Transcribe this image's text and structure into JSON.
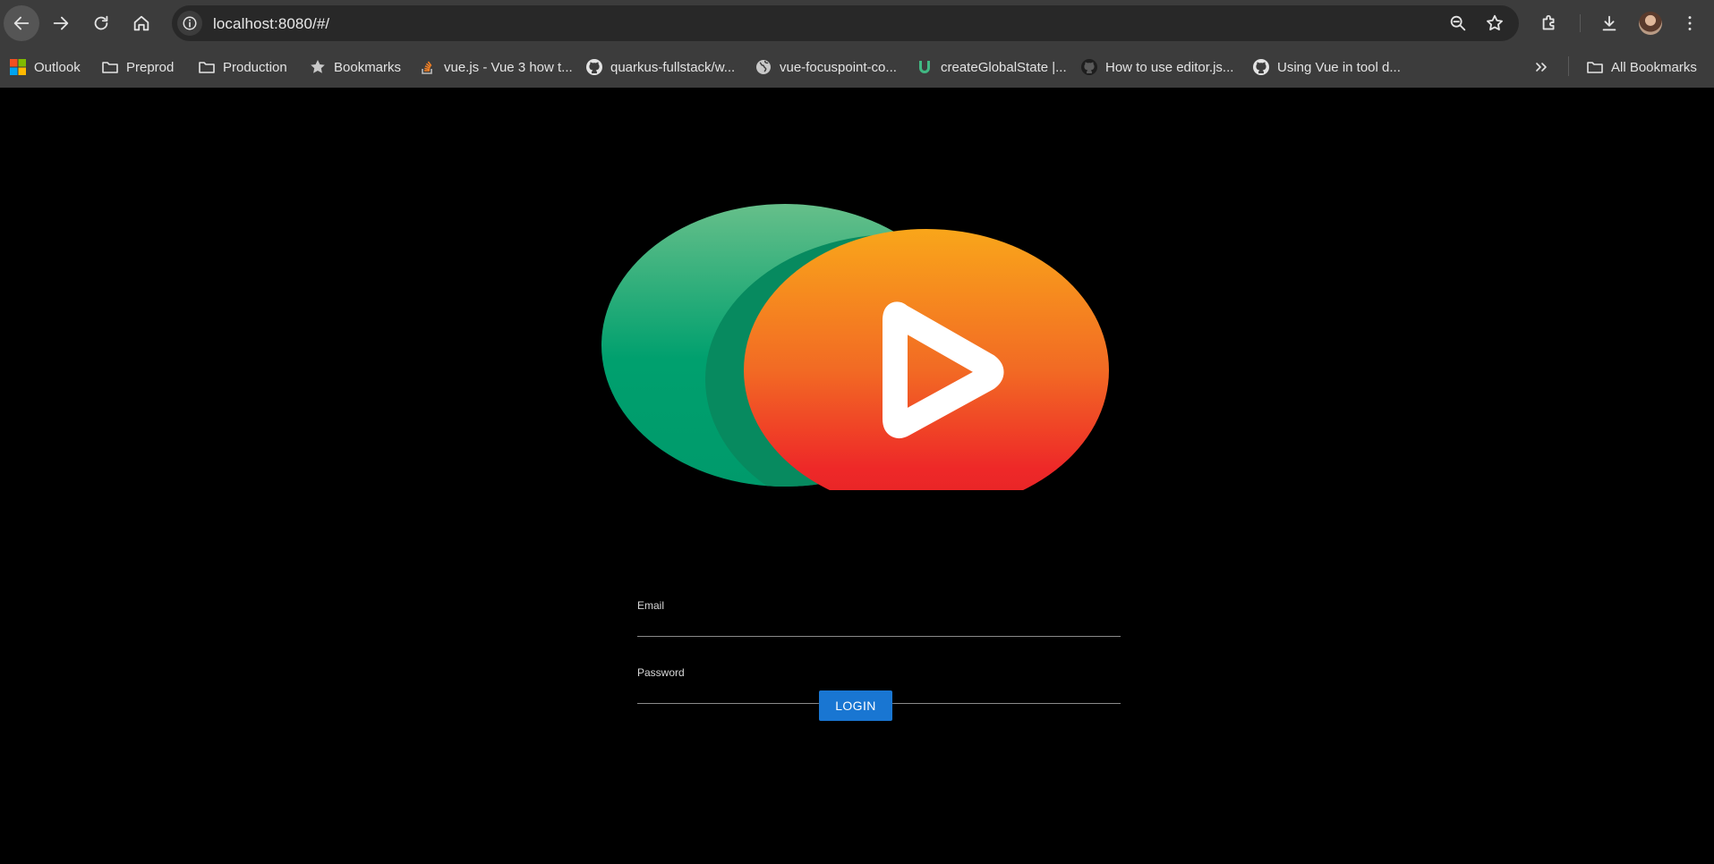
{
  "browser": {
    "url": "localhost:8080/#/",
    "bookmarks": [
      {
        "label": "Outlook",
        "icon": "microsoft-icon"
      },
      {
        "label": "Preprod",
        "icon": "folder-icon"
      },
      {
        "label": "Production",
        "icon": "folder-icon"
      },
      {
        "label": "Bookmarks",
        "icon": "star-icon"
      },
      {
        "label": "vue.js - Vue 3 how t...",
        "icon": "stackoverflow-icon"
      },
      {
        "label": "quarkus-fullstack/w...",
        "icon": "github-icon"
      },
      {
        "label": "vue-focuspoint-co...",
        "icon": "globe-icon"
      },
      {
        "label": "createGlobalState |...",
        "icon": "vueuse-icon"
      },
      {
        "label": "How to use editor.js...",
        "icon": "github-icon"
      },
      {
        "label": "Using Vue in tool d...",
        "icon": "github-icon"
      }
    ],
    "all_bookmarks_label": "All Bookmarks"
  },
  "login": {
    "email_label": "Email",
    "email_value": "",
    "password_label": "Password",
    "password_value": "",
    "button_label": "LOGIN"
  },
  "colors": {
    "page_background": "#000000",
    "button": "#1976d2",
    "logo_green": "#00a06e",
    "logo_orange": "#f7941d",
    "logo_red": "#ee2828"
  }
}
